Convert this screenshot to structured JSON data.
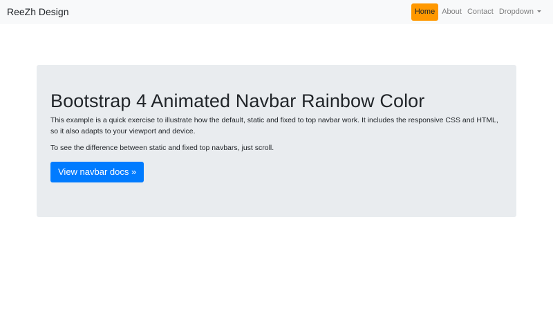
{
  "navbar": {
    "brand": "ReeZh Design",
    "items": [
      {
        "label": "Home",
        "active": true
      },
      {
        "label": "About",
        "active": false
      },
      {
        "label": "Contact",
        "active": false
      },
      {
        "label": "Dropdown",
        "active": false,
        "has_caret": true
      }
    ],
    "active_color": "#ff9800"
  },
  "jumbotron": {
    "title": "Bootstrap 4 Animated Navbar Rainbow Color",
    "paragraph1": "This example is a quick exercise to illustrate how the default, static and fixed to top navbar work. It includes the responsive CSS and HTML, so it also adapts to your viewport and device.",
    "paragraph2": "To see the difference between static and fixed top navbars, just scroll.",
    "button_label": "View navbar docs »",
    "button_color": "#007bff"
  }
}
